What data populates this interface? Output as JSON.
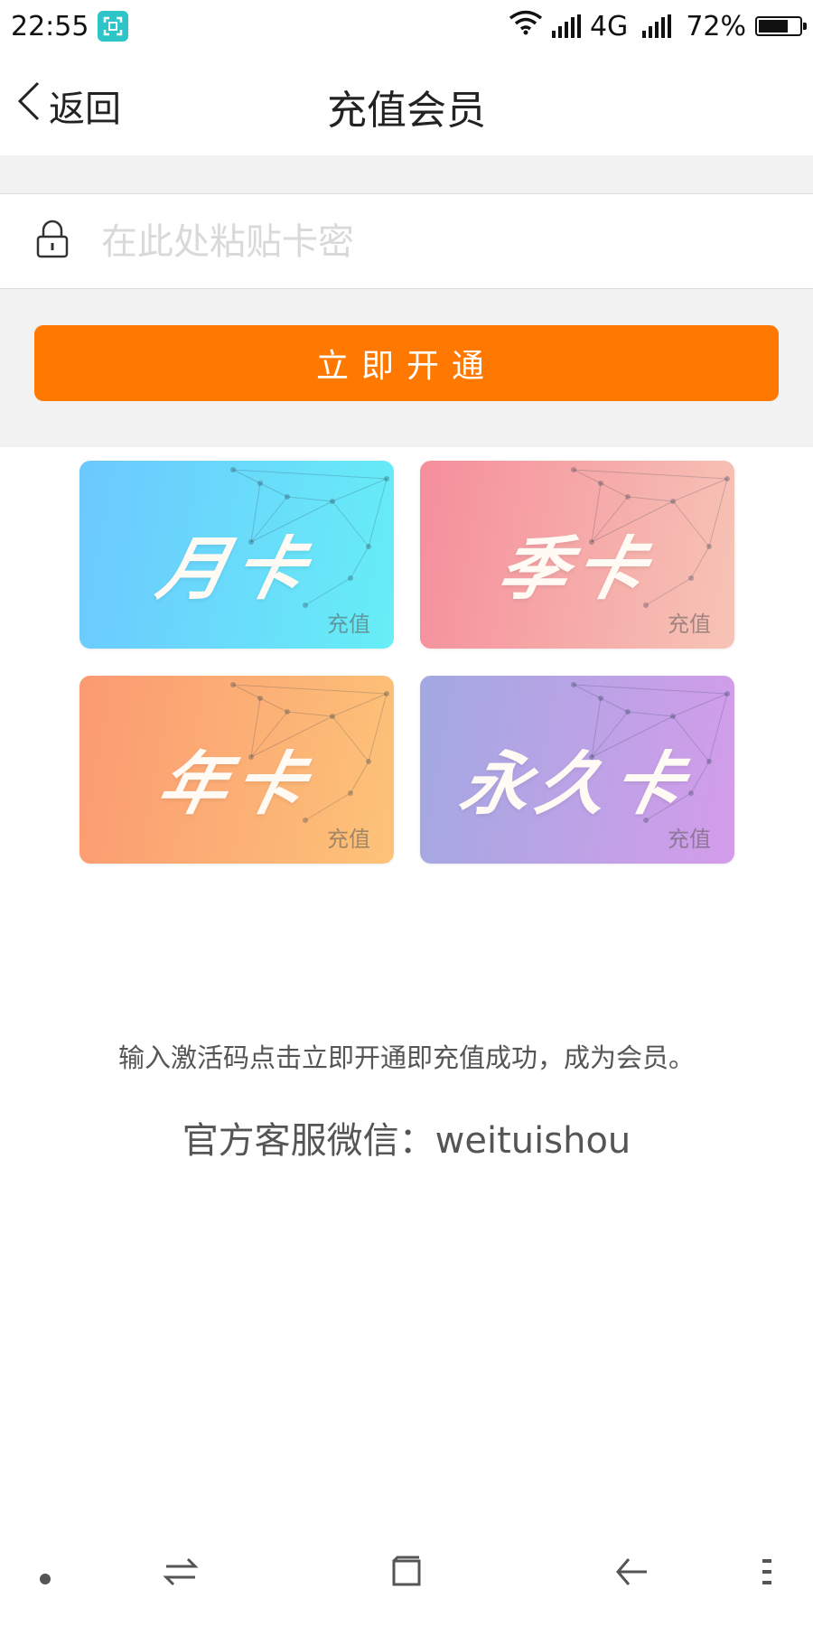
{
  "status_bar": {
    "time": "22:55",
    "network": "4G",
    "battery_text": "72%",
    "battery_level": 0.72
  },
  "nav": {
    "back_label": "返回",
    "title": "充值会员"
  },
  "card_key_input": {
    "placeholder": "在此处粘贴卡密",
    "value": ""
  },
  "activate_button": {
    "label": "立即开通",
    "color": "#ff7800"
  },
  "cards": [
    {
      "name": "月卡",
      "tag": "充值",
      "colors": [
        "#6cc8ff",
        "#66eef6"
      ]
    },
    {
      "name": "季卡",
      "tag": "充值",
      "colors": [
        "#f58e9b",
        "#f7c4b6"
      ]
    },
    {
      "name": "年卡",
      "tag": "充值",
      "colors": [
        "#fb9a72",
        "#fdc378"
      ]
    },
    {
      "name": "永久卡",
      "tag": "充值",
      "colors": [
        "#a2a9e2",
        "#d49cea"
      ]
    }
  ],
  "info": {
    "instruction": "输入激活码点击立即开通即充值成功，成为会员。",
    "service": "官方客服微信：weituishou"
  },
  "icons": [
    "scan-icon",
    "wifi-icon",
    "signal-icon",
    "battery-icon",
    "chevron-left-icon",
    "lock-icon",
    "dot-icon",
    "switch-icon",
    "home-square-icon",
    "back-arrow-icon",
    "menu-icon"
  ]
}
